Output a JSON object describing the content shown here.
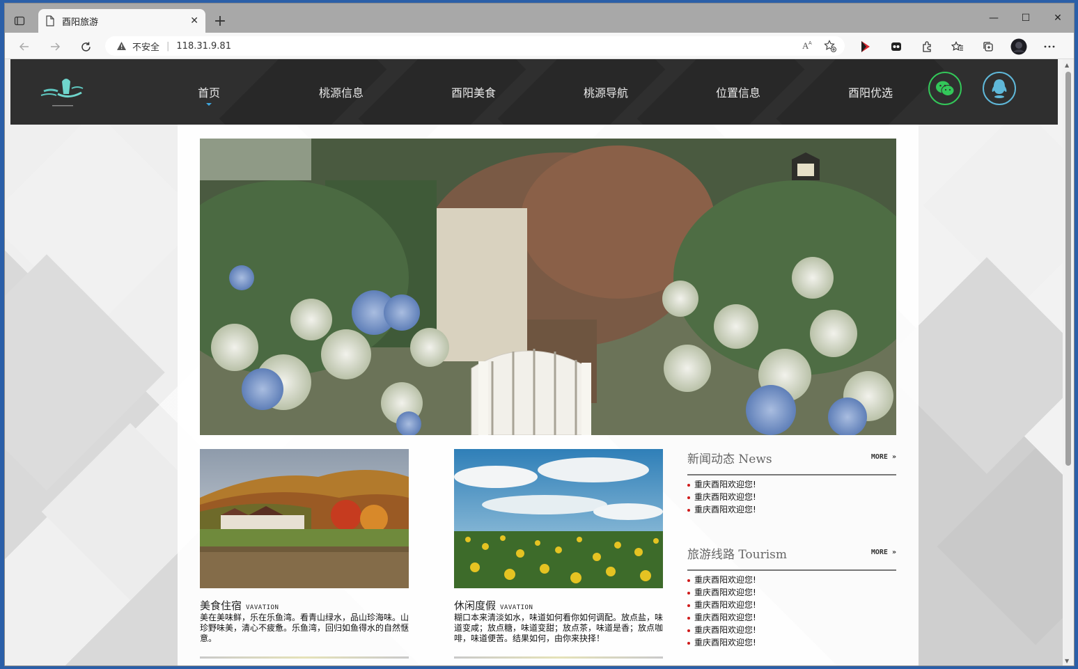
{
  "browser": {
    "tab_title": "酉阳旅游",
    "tab_close": "✕",
    "new_tab": "+",
    "security_label": "不安全",
    "url": "118.31.9.81",
    "min": "—",
    "max": "☐",
    "close": "✕"
  },
  "site": {
    "nav": [
      "首页",
      "桃源信息",
      "酉阳美食",
      "桃源导航",
      "位置信息",
      "酉阳优选"
    ],
    "active_nav": 0
  },
  "cards": [
    {
      "title": "美食住宿",
      "tag": "VAVATION",
      "desc": "美在美味鲜，乐在乐鱼湾。看青山绿水，品山珍海味。山珍野味美，清心不疲惫。乐鱼湾，回归如鱼得水的自然惬意。"
    },
    {
      "title": "休闲度假",
      "tag": "VAVATION",
      "desc": "糊口本来清淡如水，味道如何看你如何调配。放点盐，味道变咸；放点糖，味道变甜；放点茶，味道是香；放点咖啡，味道便苦。结果如何，由你来抉择！"
    }
  ],
  "news": {
    "title": "新闻动态 News",
    "more": "MORE »",
    "items": [
      "重庆酉阳欢迎您!",
      "重庆酉阳欢迎您!",
      "重庆酉阳欢迎您!"
    ]
  },
  "tourism": {
    "title": "旅游线路 Tourism",
    "more": "MORE »",
    "items": [
      "重庆酉阳欢迎您!",
      "重庆酉阳欢迎您!",
      "重庆酉阳欢迎您!",
      "重庆酉阳欢迎您!",
      "重庆酉阳欢迎您!",
      "重庆酉阳欢迎您!"
    ]
  },
  "colors": {
    "header_bg": "#2f2f2f",
    "nav_active": "#3fa7e0",
    "wechat": "#33c759",
    "qq": "#5fb8d9",
    "bullet": "#d01a1a"
  }
}
